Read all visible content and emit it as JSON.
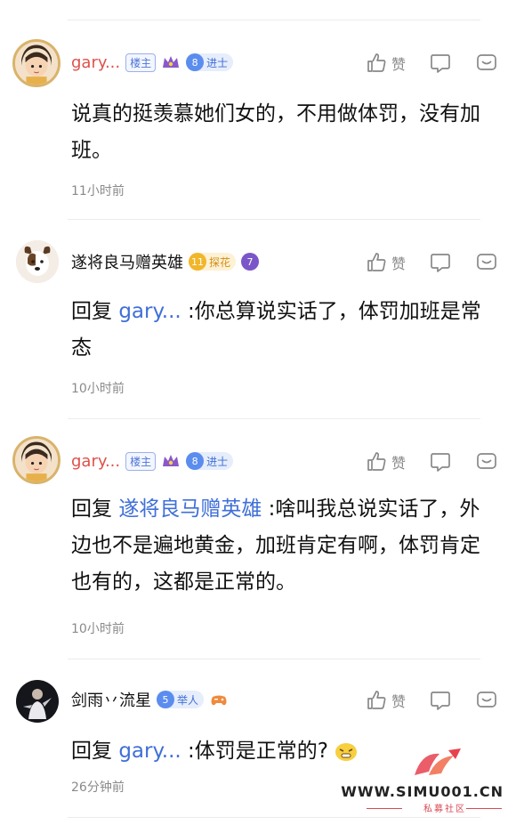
{
  "comments": [
    {
      "username": "gary...",
      "tag": "楼主",
      "level_num": "8",
      "level_label": "进士",
      "like_label": "赞",
      "text": "说真的挺羡慕她们女的，不用做体罚，没有加班。",
      "time": "11小时前"
    },
    {
      "username": "遂将良马赠英雄",
      "level_num": "11",
      "level_label": "探花",
      "medal_num": "7",
      "like_label": "赞",
      "reply_prefix": "回复",
      "mention": "gary...",
      "text": " :你总算说实话了，体罚加班是常态",
      "time": "10小时前"
    },
    {
      "username": "gary...",
      "tag": "楼主",
      "level_num": "8",
      "level_label": "进士",
      "like_label": "赞",
      "reply_prefix": "回复",
      "mention": "遂将良马赠英雄",
      "text": " :啥叫我总说实话了，外边也不是遍地黄金，加班肯定有啊，体罚肯定也有的，这都是正常的。",
      "time": "10小时前"
    },
    {
      "username": "剑雨丷流星",
      "level_num": "5",
      "level_label": "举人",
      "like_label": "赞",
      "reply_prefix": "回复",
      "mention": "gary...",
      "text": " :体罚是正常的?",
      "time": "26分钟前"
    }
  ],
  "watermark": {
    "text": "WWW.SIMU001.CN",
    "subtitle": "私募社区"
  },
  "colors": {
    "mention": "#3f6fd8",
    "gary_name": "#e0504a",
    "time": "#8a8a8a"
  },
  "icons": [
    "thumb-up-icon",
    "comment-icon",
    "more-icon",
    "crown-icon"
  ]
}
